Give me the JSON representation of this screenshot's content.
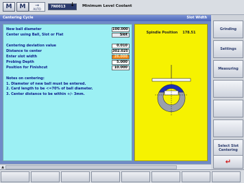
{
  "topbar": {
    "m_label": "M",
    "auto_label": "AUTO",
    "auto_arrow": "→",
    "program": "7N0013",
    "title": "Minimum Level Coolant"
  },
  "header": {
    "left": "Centering Cycle",
    "right": "Slot Width"
  },
  "form": {
    "rows": [
      {
        "label": "New ball diameter",
        "value": "100.000"
      },
      {
        "label": "Center using Ball, Slot or Flat",
        "value": "Slot"
      },
      {
        "label": "Centering deviation value",
        "value": "0.010"
      },
      {
        "label": "Distance to center",
        "value": "302.025"
      },
      {
        "label": "Enter slot width",
        "value": "26.000"
      },
      {
        "label": "Probing Depth",
        "value": "5.000"
      },
      {
        "label": "Position for Finishcut",
        "value": "10.000"
      }
    ],
    "notes_title": "Notes on centering:",
    "notes": [
      "1. Diameter of new ball must be entered.",
      "2. Card length to be <=70% of ball diameter.",
      "3. Center distance to be within +/- 3mm."
    ]
  },
  "diagram": {
    "spindle_label": "Spindle Position",
    "spindle_value": "178.51"
  },
  "softkeys": {
    "grinding": "Grinding",
    "settings": "Settings",
    "measuring": "Measuring",
    "select_slot": "Select Slot Centering",
    "exit": "↵"
  },
  "colors": {
    "panel_cyan": "#9cf0f4",
    "panel_yellow": "#f6f200",
    "highlight": "#f08a18",
    "header_blue": "#4c66b8"
  }
}
